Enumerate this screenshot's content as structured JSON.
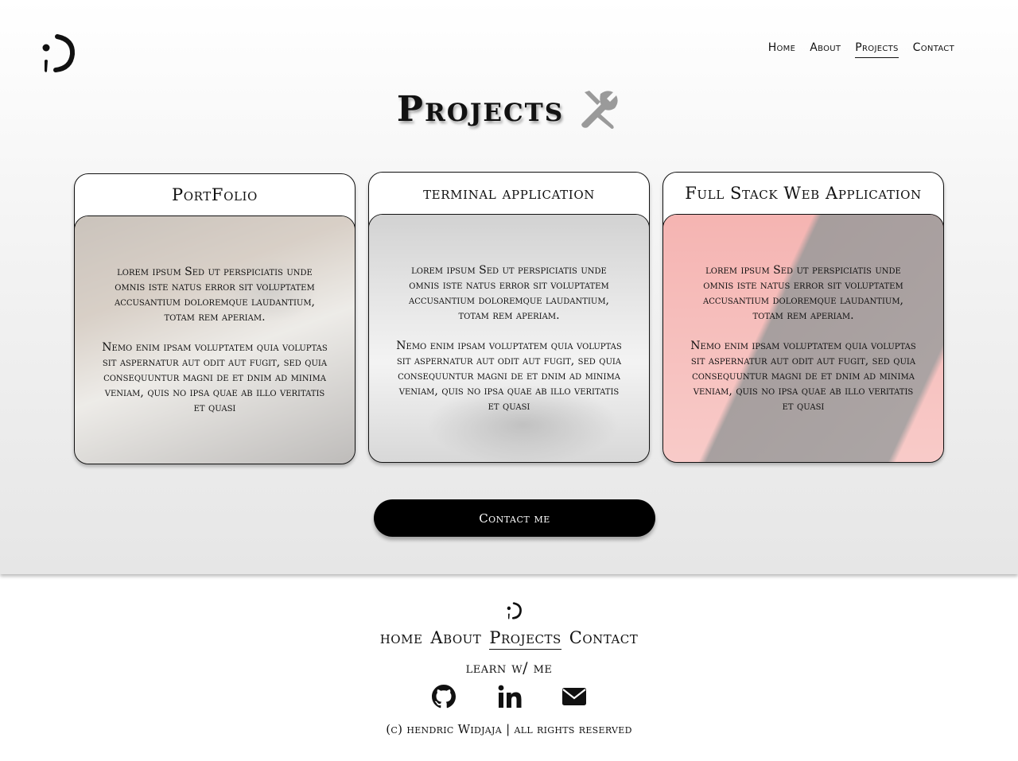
{
  "header": {
    "nav": [
      {
        "label": "Home"
      },
      {
        "label": "About"
      },
      {
        "label": "Projects"
      },
      {
        "label": "Contact"
      }
    ]
  },
  "page": {
    "title": "Projects",
    "title_icon": "tools-icon"
  },
  "cards": [
    {
      "title": "PortFolio",
      "paragraphs": [
        "lorem ipsum Sed ut perspiciatis unde omnis iste natus error sit voluptatem accusantium doloremque laudantium, totam rem aperiam.",
        "Nemo enim ipsam voluptatem quia voluptas sit aspernatur aut odit aut fugit, sed quia consequuntur magni de et dnim ad minima veniam, quis no ipsa quae ab illo  veritatis et quasi"
      ]
    },
    {
      "title": "terminal application",
      "paragraphs": [
        "lorem ipsum Sed ut perspiciatis unde omnis iste natus error sit voluptatem accusantium doloremque laudantium, totam rem aperiam.",
        "Nemo enim ipsam voluptatem quia voluptas sit aspernatur aut odit aut fugit, sed quia consequuntur magni de et dnim ad minima veniam, quis no ipsa quae ab illo  veritatis et quasi"
      ]
    },
    {
      "title": "Full Stack Web Application",
      "paragraphs": [
        "lorem ipsum Sed ut perspiciatis unde omnis iste natus error sit voluptatem accusantium doloremque laudantium, totam rem aperiam.",
        "Nemo enim ipsam voluptatem quia voluptas sit aspernatur aut odit aut fugit, sed quia consequuntur magni de et dnim ad minima veniam, quis no ipsa quae ab illo  veritatis et quasi"
      ]
    }
  ],
  "contact_button": {
    "label": "Contact me"
  },
  "footer": {
    "nav": [
      {
        "label": "home"
      },
      {
        "label": "About"
      },
      {
        "label": "Projects"
      },
      {
        "label": "Contact"
      }
    ],
    "learn": "learn w/ me",
    "social": [
      {
        "icon": "github-icon"
      },
      {
        "icon": "linkedin-icon"
      },
      {
        "icon": "email-icon"
      }
    ],
    "copyright": "(c) hendric Widjaja | all rights reserved"
  },
  "colors": {
    "accent": "#000000",
    "card_border": "#111111",
    "page_background": "#ffffff"
  }
}
